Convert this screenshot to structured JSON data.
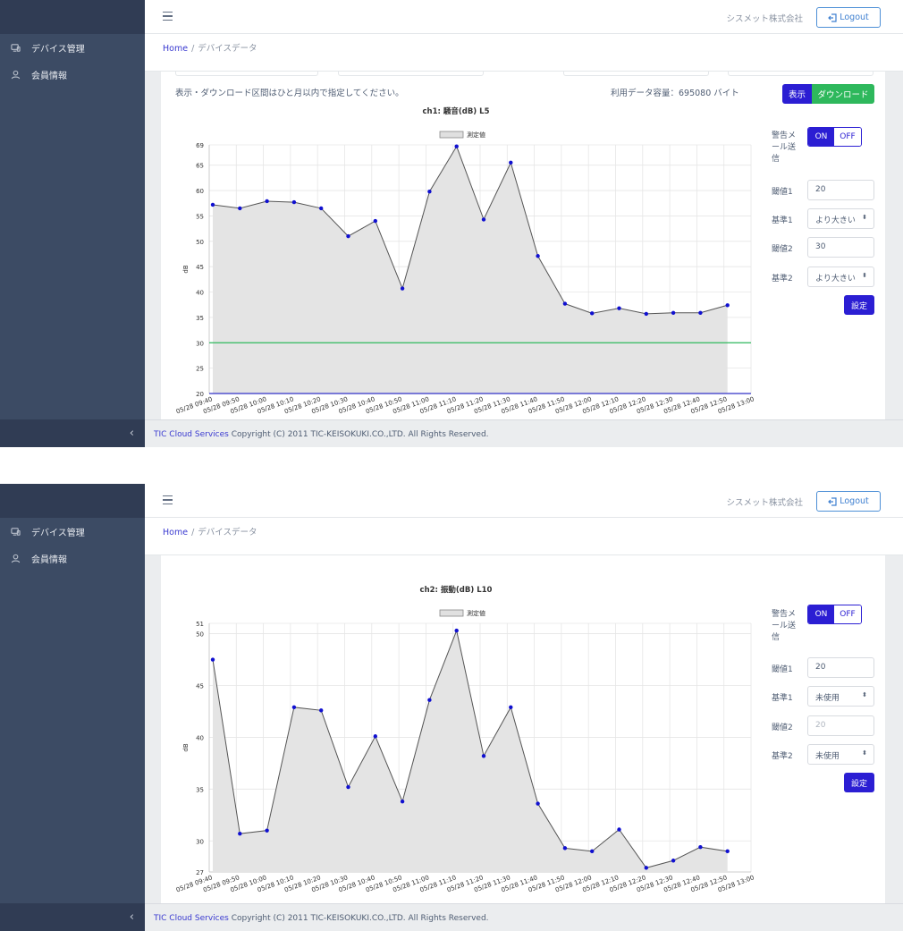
{
  "sidebar": {
    "items": [
      {
        "label": "デバイス管理",
        "icon": "devices-icon"
      },
      {
        "label": "会員情報",
        "icon": "user-icon"
      }
    ],
    "toggler": "‹"
  },
  "header": {
    "company": "シスメット株式会社",
    "logout": "Logout"
  },
  "breadcrumb": {
    "home": "Home",
    "sep": "/",
    "current": "デバイスデータ"
  },
  "toolbar": {
    "notice": "表示・ダウンロード区間はひと月以内で指定してください。",
    "usage": "利用データ容量：695080 バイト",
    "show_label": "表示",
    "download_label": "ダウンロード"
  },
  "panel1": {
    "alert_label": "警告メール送信",
    "on": "ON",
    "off": "OFF",
    "threshold1_label": "閾値1",
    "threshold1_value": "20",
    "criteria1_label": "基準1",
    "criteria1_value": "より大きい",
    "threshold2_label": "閾値2",
    "threshold2_value": "30",
    "criteria2_label": "基準2",
    "criteria2_value": "より大きい",
    "set_label": "設定"
  },
  "panel2": {
    "alert_label": "警告メール送信",
    "on": "ON",
    "off": "OFF",
    "threshold1_label": "閾値1",
    "threshold1_value": "20",
    "criteria1_label": "基準1",
    "criteria1_value": "未使用",
    "threshold2_label": "閾値2",
    "threshold2_value": "20",
    "criteria2_label": "基準2",
    "criteria2_value": "未使用",
    "set_label": "設定"
  },
  "footer": {
    "link": "TIC Cloud Services",
    "text": " Copyright (C) 2011 TIC-KEISOKUKI.CO.,LTD. All Rights Reserved."
  },
  "chart_data": [
    {
      "type": "area",
      "title": "ch1: 騒音(dB) L5",
      "ylabel": "dB",
      "legend": "測定値",
      "legend_position": "top",
      "ylim": [
        20,
        69
      ],
      "yticks": [
        20,
        25,
        30,
        35,
        40,
        45,
        50,
        55,
        60,
        65,
        69
      ],
      "categories": [
        "05/28 09:40",
        "05/28 09:50",
        "05/28 10:00",
        "05/28 10:10",
        "05/28 10:20",
        "05/28 10:30",
        "05/28 10:40",
        "05/28 10:50",
        "05/28 11:00",
        "05/28 11:10",
        "05/28 11:20",
        "05/28 11:30",
        "05/28 11:40",
        "05/28 11:50",
        "05/28 12:00",
        "05/28 12:10",
        "05/28 12:20",
        "05/28 12:30",
        "05/28 12:40",
        "05/28 12:50",
        "05/28 13:00"
      ],
      "series": [
        {
          "name": "測定値",
          "values": [
            57.2,
            56.5,
            57.9,
            57.7,
            56.5,
            51.0,
            54.0,
            40.7,
            59.8,
            68.7,
            54.3,
            65.5,
            47.1,
            37.7,
            35.8,
            36.8,
            35.7,
            35.9,
            35.9,
            37.4
          ]
        }
      ],
      "threshold_lines": [
        {
          "value": 30,
          "color": "#2eb85c"
        },
        {
          "value": 20,
          "color": "#3232c8"
        }
      ],
      "grid": true
    },
    {
      "type": "area",
      "title": "ch2: 振動(dB) L10",
      "ylabel": "dB",
      "legend": "測定値",
      "legend_position": "top",
      "ylim": [
        27,
        51
      ],
      "yticks": [
        27,
        30,
        35,
        40,
        45,
        50,
        51
      ],
      "categories": [
        "05/28 09:40",
        "05/28 09:50",
        "05/28 10:00",
        "05/28 10:10",
        "05/28 10:20",
        "05/28 10:30",
        "05/28 10:40",
        "05/28 10:50",
        "05/28 11:00",
        "05/28 11:10",
        "05/28 11:20",
        "05/28 11:30",
        "05/28 11:40",
        "05/28 11:50",
        "05/28 12:00",
        "05/28 12:10",
        "05/28 12:20",
        "05/28 12:30",
        "05/28 12:40",
        "05/28 12:50",
        "05/28 13:00"
      ],
      "series": [
        {
          "name": "測定値",
          "values": [
            47.5,
            30.7,
            31.0,
            42.9,
            42.6,
            35.2,
            40.1,
            33.8,
            43.6,
            50.3,
            38.2,
            42.9,
            33.6,
            29.3,
            29.0,
            31.1,
            27.4,
            28.1,
            29.4,
            29.0
          ]
        }
      ],
      "threshold_lines": [],
      "grid": true
    }
  ]
}
